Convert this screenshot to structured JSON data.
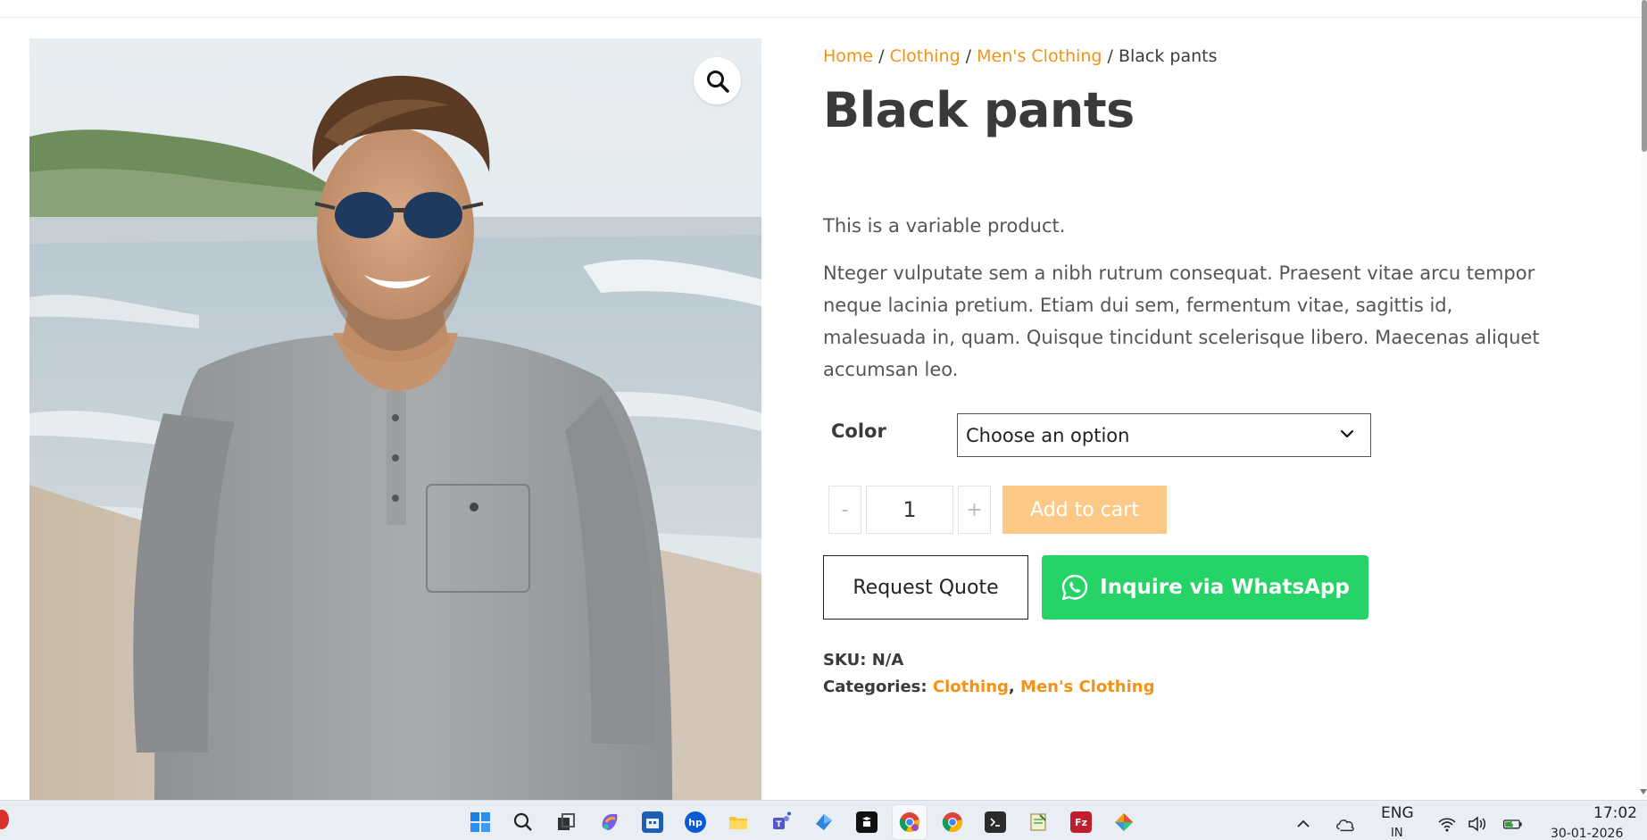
{
  "breadcrumb": {
    "home": "Home",
    "sep1": " / ",
    "clothing": "Clothing",
    "sep2": " / ",
    "mens": "Men's Clothing",
    "sep3": " / ",
    "current": "Black pants"
  },
  "product": {
    "title": "Black pants",
    "short_description": "This is a variable product.",
    "long_description": "Nteger vulputate sem a nibh rutrum consequat. Praesent vitae arcu tempor neque lacinia pretium. Etiam dui sem, fermentum vitae, sagittis id, malesuada in, quam. Quisque tincidunt scelerisque libero. Maecenas aliquet accumsan leo.",
    "image_icon": "zoom-magnifier-icon"
  },
  "variation": {
    "label": "Color",
    "selected": "Choose an option"
  },
  "cart": {
    "minus": "-",
    "quantity": "1",
    "plus": "+",
    "add_to_cart": "Add to cart"
  },
  "actions": {
    "request_quote": "Request Quote",
    "whatsapp": "Inquire via WhatsApp"
  },
  "meta": {
    "sku_label": "SKU:",
    "sku_value": "N/A",
    "categories_label": "Categories:",
    "category_1": "Clothing",
    "category_sep": ", ",
    "category_2": "Men's Clothing"
  },
  "colors": {
    "accent": "#f39213",
    "add_to_cart_bg": "#fdc986",
    "whatsapp_green": "#25d366",
    "text": "#3a3a3a"
  },
  "taskbar": {
    "apps": [
      "start-icon",
      "search-icon",
      "task-view-icon",
      "copilot-icon",
      "store-icon",
      "hp-icon",
      "file-explorer-icon",
      "teams-icon",
      "app-icon",
      "notion-icon",
      "chrome-icon",
      "chrome-profile-icon",
      "terminal-icon",
      "notepad-icon",
      "filezilla-icon",
      "app-icon-2"
    ],
    "language": "ENG",
    "language_sub": "IN",
    "time": "17:02",
    "date": "30-01-2026"
  }
}
